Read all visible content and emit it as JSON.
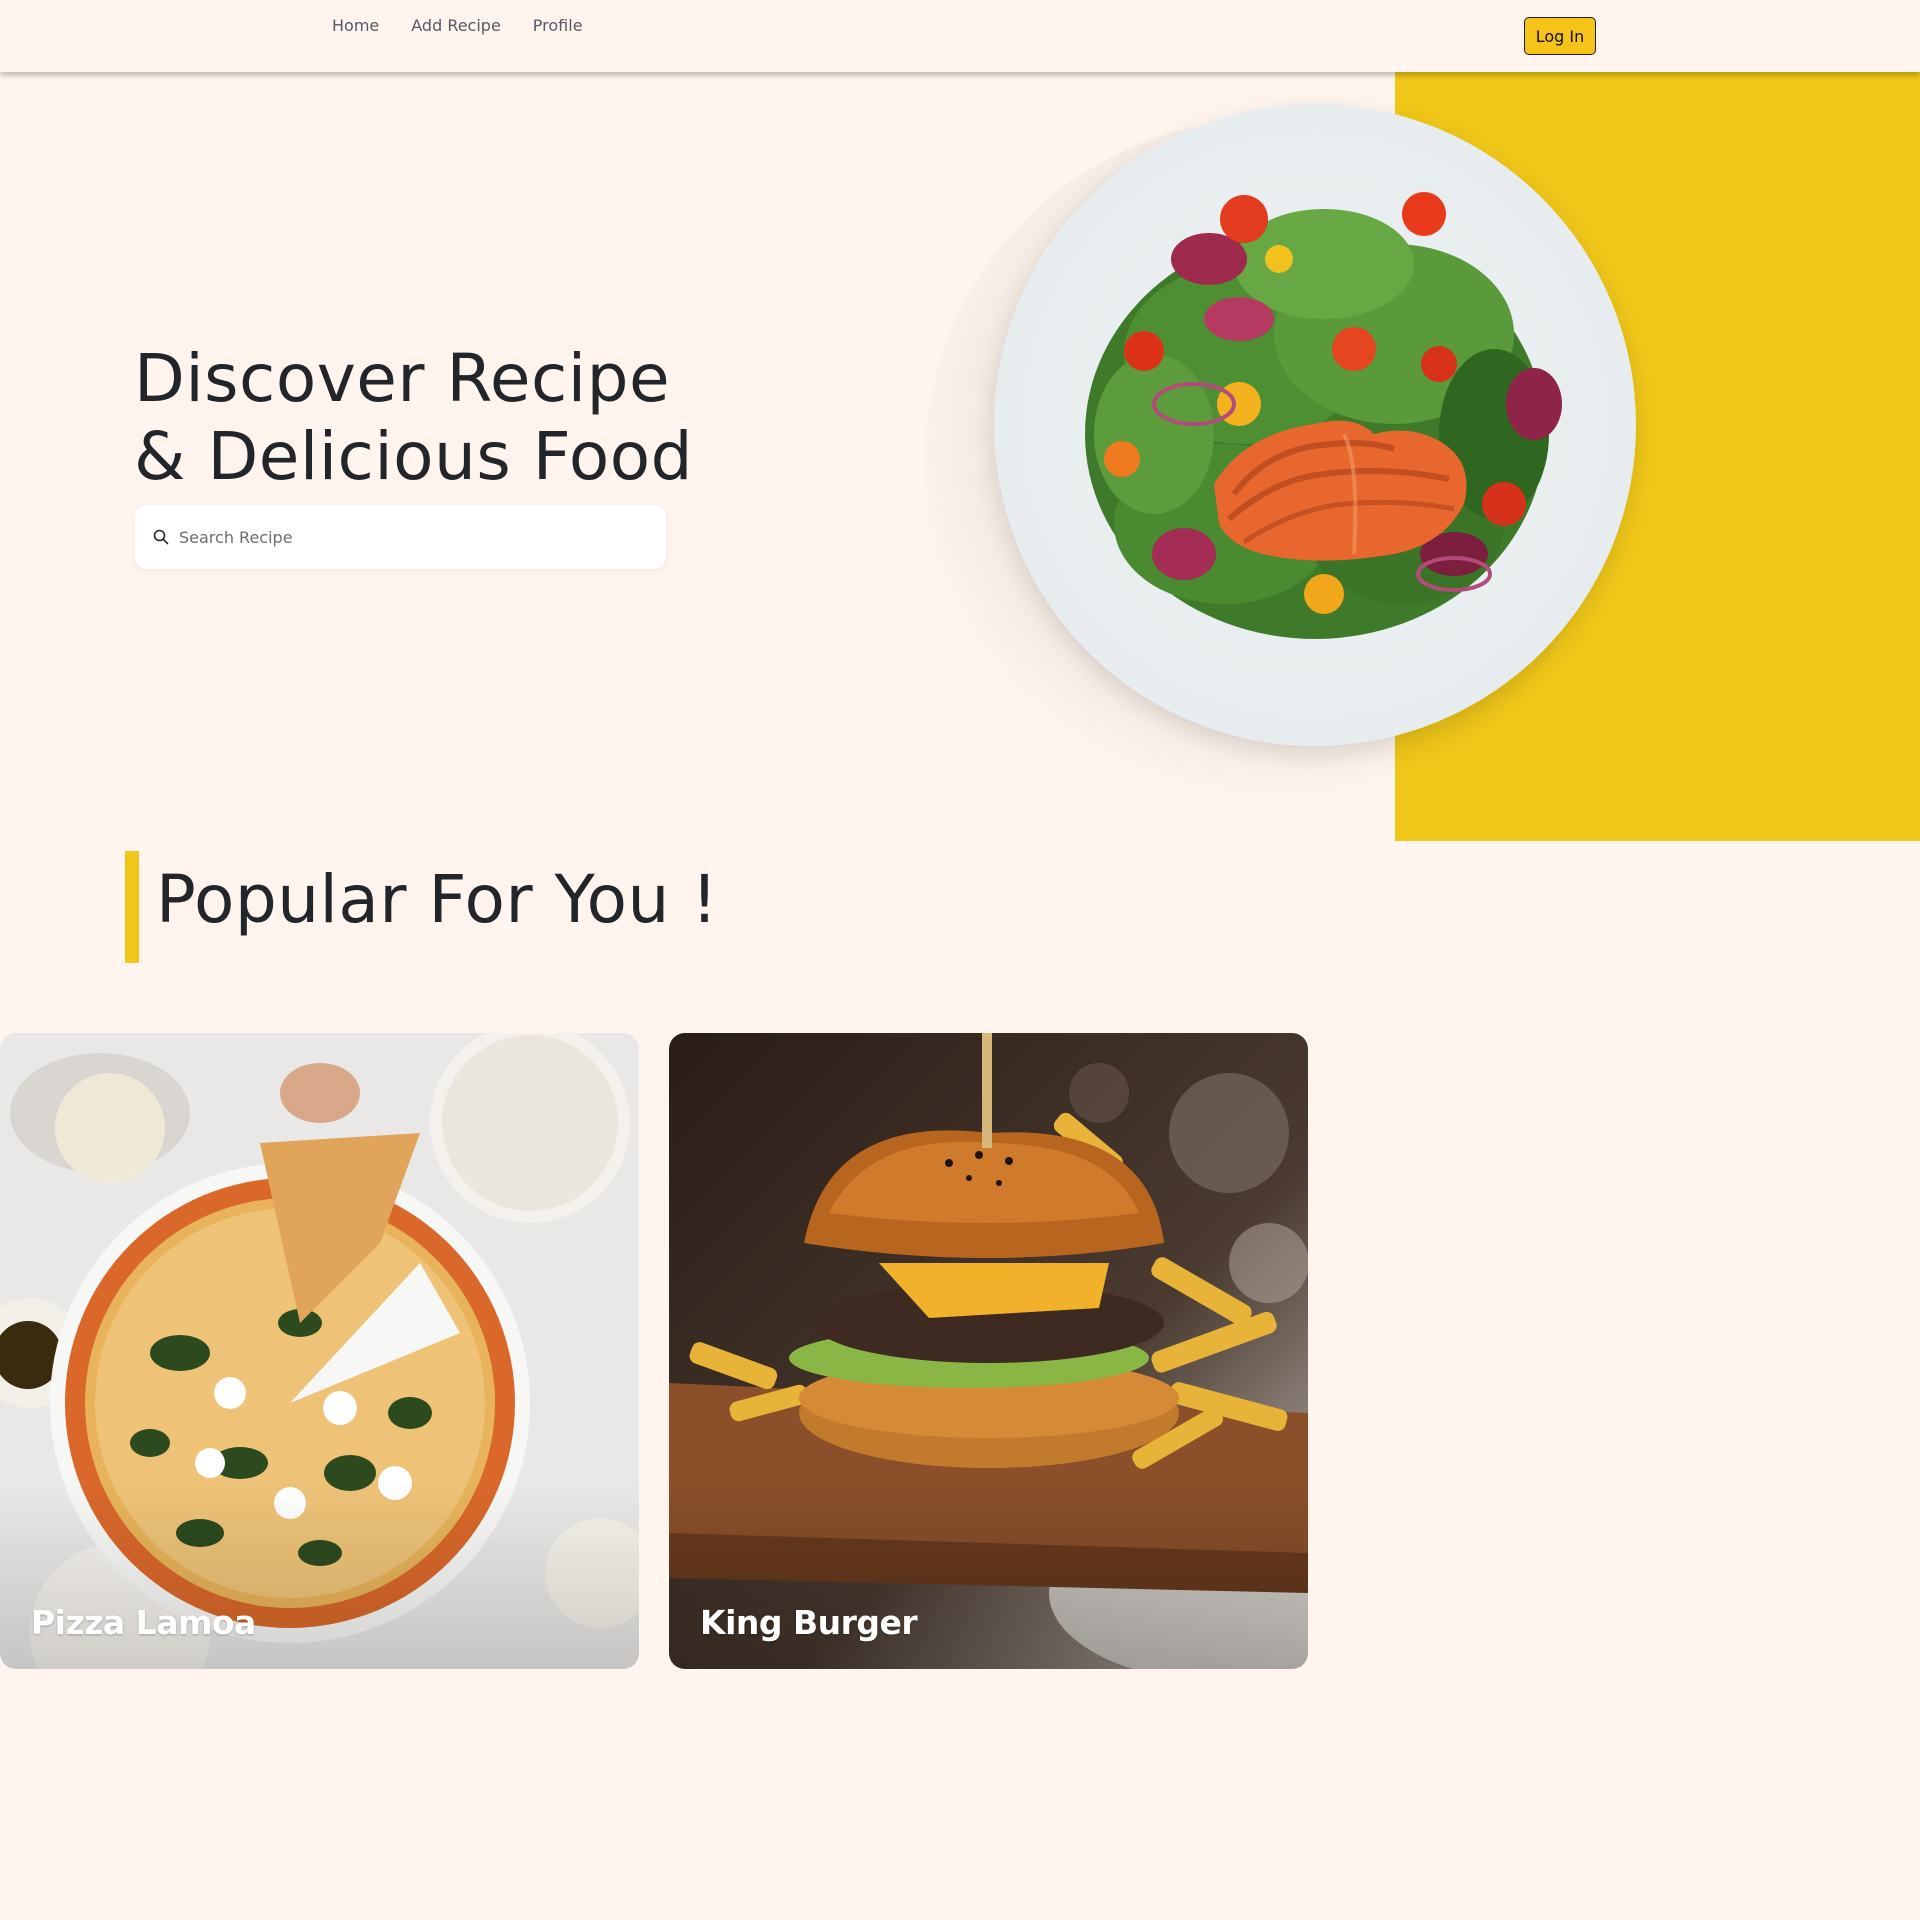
{
  "nav": {
    "items": [
      "Home",
      "Add Recipe",
      "Profile"
    ],
    "login_label": "Log In"
  },
  "hero": {
    "title_line1": "Discover Recipe",
    "title_line2": "& Delicious Food",
    "search_placeholder": "Search Recipe"
  },
  "popular": {
    "title": "Popular For You !",
    "cards": [
      {
        "title": "Pizza Lamoa"
      },
      {
        "title": "King Burger"
      }
    ]
  },
  "colors": {
    "background": "#fff5ee",
    "accent_yellow": "#f0c719",
    "button_yellow": "#f6c419",
    "text_dark": "#22252a"
  },
  "icons": [
    "search-icon"
  ]
}
